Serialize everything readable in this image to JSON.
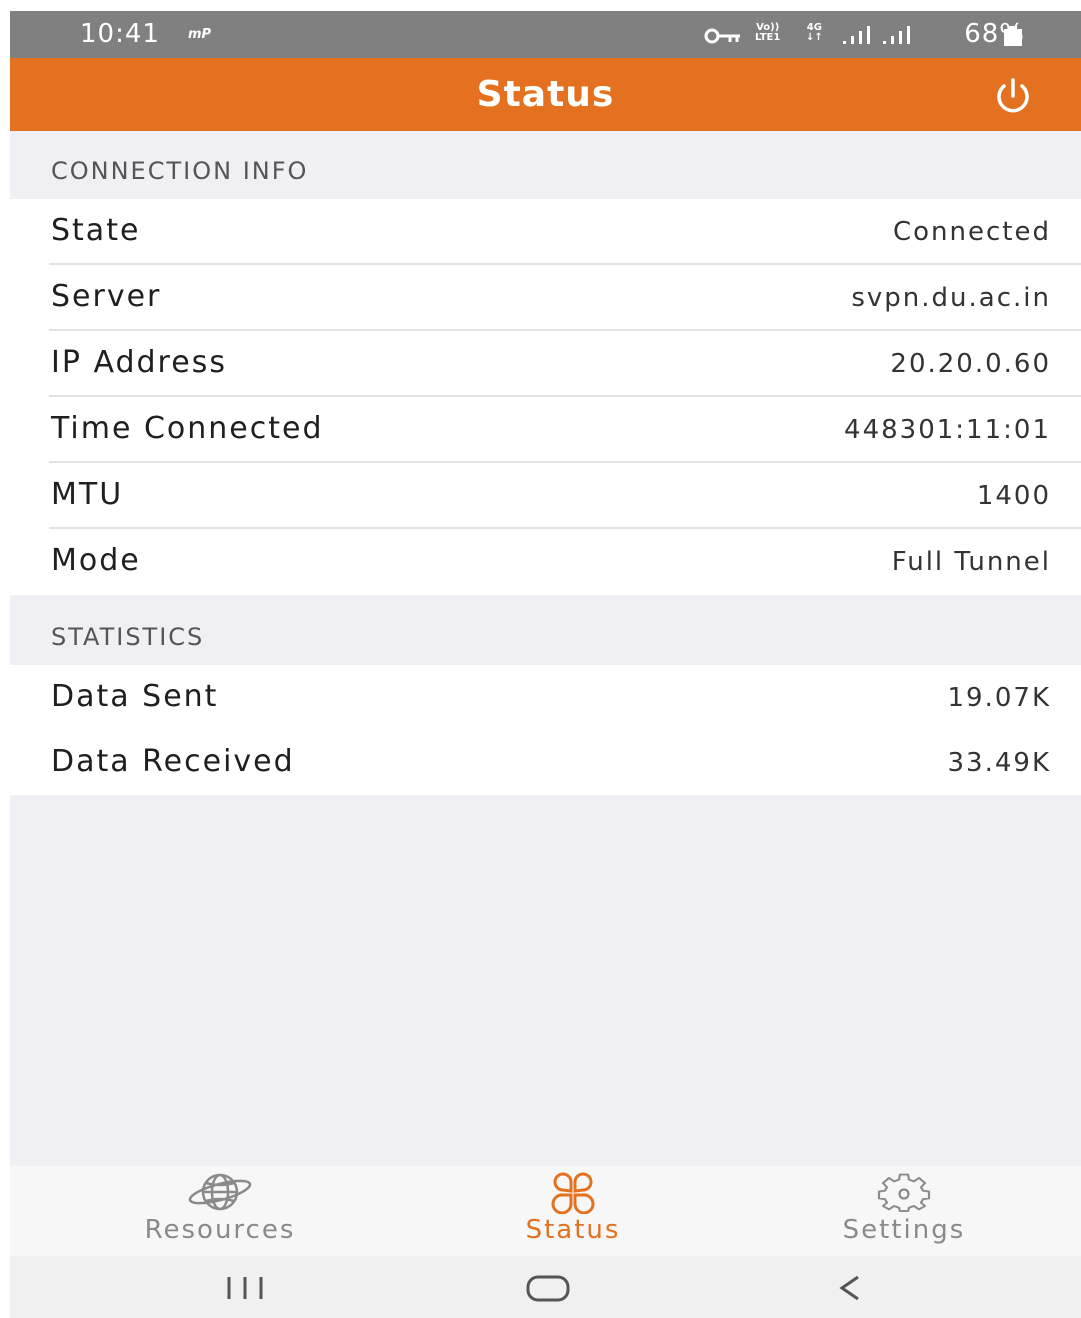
{
  "status_bar": {
    "time": "10:41",
    "mp_label": "mP",
    "lte_label_top": "Vo))",
    "lte_label_bottom": "LTE1",
    "net_label": "4G",
    "battery": "68%",
    "icons": [
      "key-icon",
      "signal-icon",
      "battery-icon"
    ]
  },
  "app_bar": {
    "title": "Status",
    "power_icon": "power-icon"
  },
  "connection_info": {
    "header": "CONNECTION INFO",
    "rows": [
      {
        "label": "State",
        "value": "Connected"
      },
      {
        "label": "Server",
        "value": "svpn.du.ac.in"
      },
      {
        "label": "IP Address",
        "value": "20.20.0.60"
      },
      {
        "label": "Time Connected",
        "value": "448301:11:01"
      },
      {
        "label": "MTU",
        "value": "1400"
      },
      {
        "label": "Mode",
        "value": "Full Tunnel"
      }
    ]
  },
  "statistics": {
    "header": "STATISTICS",
    "rows": [
      {
        "label": "Data Sent",
        "value": "19.07K"
      },
      {
        "label": "Data Received",
        "value": "33.49K"
      }
    ]
  },
  "tab_bar": {
    "tabs": [
      {
        "label": "Resources",
        "icon": "globe-icon",
        "active": false
      },
      {
        "label": "Status",
        "icon": "clover-icon",
        "active": true
      },
      {
        "label": "Settings",
        "icon": "gear-icon",
        "active": false
      }
    ]
  },
  "colors": {
    "accent": "#e47120",
    "inactive_tab": "#8a8a8a",
    "status_bar": "#808080",
    "background": "#efeff4"
  },
  "nav_bar": {
    "buttons": [
      "recent-apps-icon",
      "home-icon",
      "back-icon"
    ]
  }
}
